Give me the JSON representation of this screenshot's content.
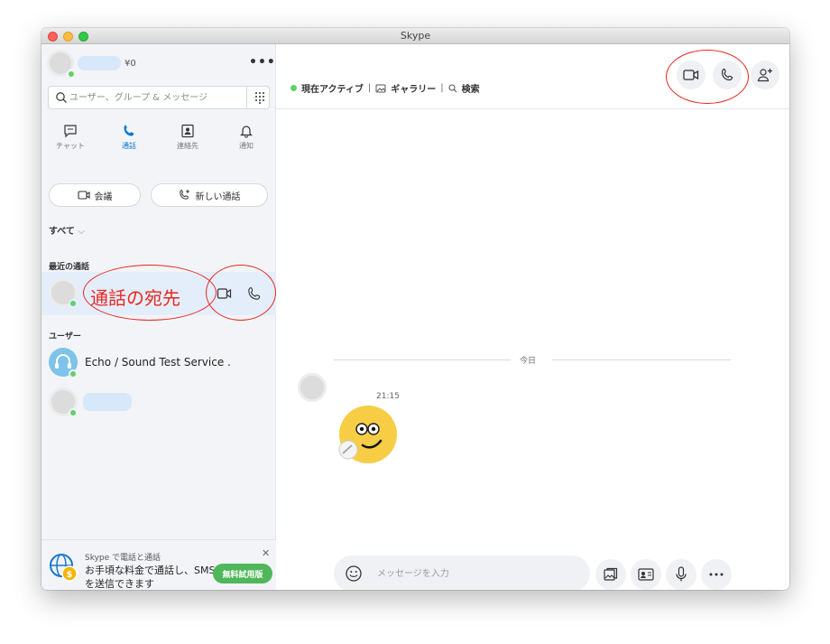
{
  "window": {
    "title": "Skype"
  },
  "sidebar": {
    "profile": {
      "credit": "¥0"
    },
    "search": {
      "placeholder": "ユーザー、グループ & メッセージ"
    },
    "tabs": [
      {
        "label": "チャット",
        "icon": "chat-icon"
      },
      {
        "label": "通話",
        "icon": "phone-icon",
        "active": true
      },
      {
        "label": "連絡先",
        "icon": "contacts-icon"
      },
      {
        "label": "通知",
        "icon": "bell-icon"
      }
    ],
    "actions": {
      "meeting": "会議",
      "new_call": "新しい通話"
    },
    "filter": {
      "label": "すべて",
      "chevron": "⌵"
    },
    "recent": {
      "title": "最近の通話",
      "recipient": "通話の宛先"
    },
    "users": {
      "title": "ユーザー",
      "echo_name": "Echo / Sound Test Service ."
    },
    "promo": {
      "small": "Skype で電話と通話",
      "text": "お手頃な料金で通話し、SMS を送信できます",
      "button": "無料試用版",
      "close": "✕"
    }
  },
  "main": {
    "header": {
      "status": "現在アクティブ",
      "gallery": "ギャラリー",
      "search": "検索",
      "separator": "|"
    },
    "conversation": {
      "date": "今日",
      "time": "21:15"
    },
    "compose": {
      "placeholder": "メッセージを入力"
    }
  },
  "colors": {
    "accent": "#0078d4",
    "online": "#5fd26b",
    "annotation": "#e8261f",
    "trial": "#4fb75a"
  }
}
